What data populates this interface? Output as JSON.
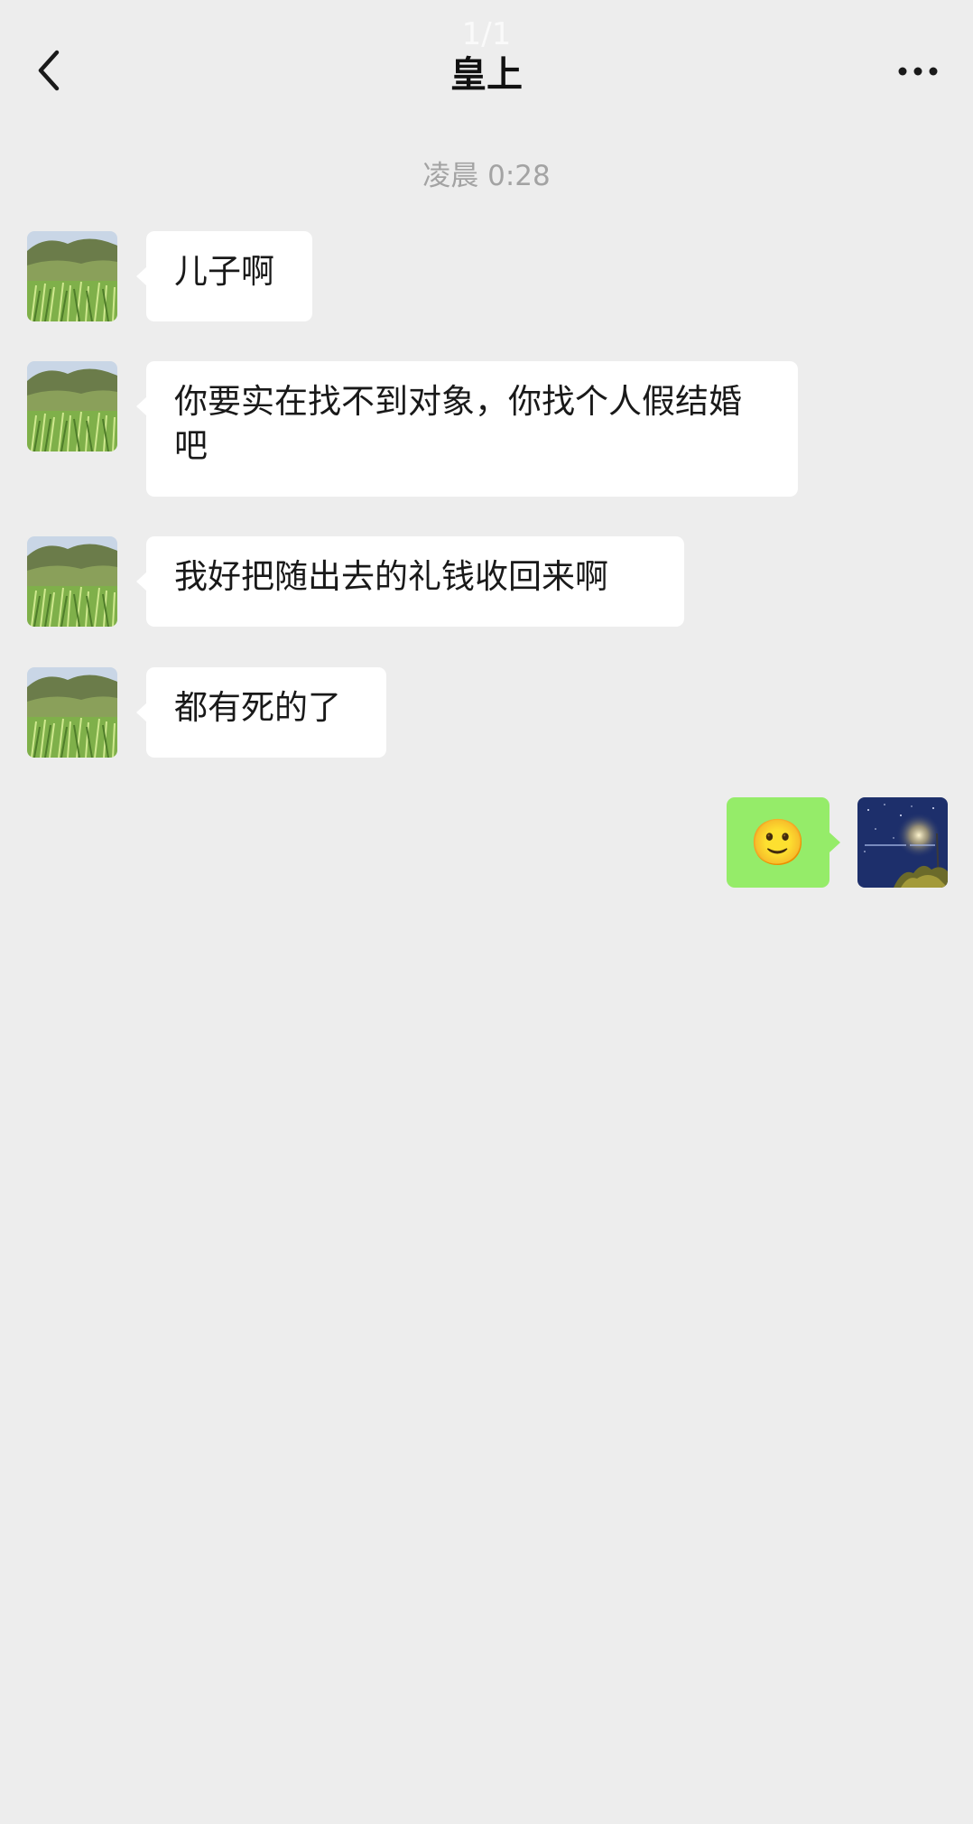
{
  "header": {
    "page_indicator": "1/1",
    "title": "皇上",
    "back_icon": "chevron-left-icon",
    "more_icon": "more-dots-icon"
  },
  "timestamp": "凌晨 0:28",
  "messages": [
    {
      "sender": "other",
      "text": "儿子啊"
    },
    {
      "sender": "other",
      "text": "你要实在找不到对象，你找个人假结婚吧"
    },
    {
      "sender": "other",
      "text": "我好把随出去的礼钱收回来啊"
    },
    {
      "sender": "other",
      "text": "都有死的了"
    },
    {
      "sender": "self",
      "text": "🙂"
    }
  ],
  "colors": {
    "background": "#ededed",
    "incoming_bubble": "#ffffff",
    "outgoing_bubble": "#95ec69",
    "timestamp": "#a3a3a3"
  }
}
